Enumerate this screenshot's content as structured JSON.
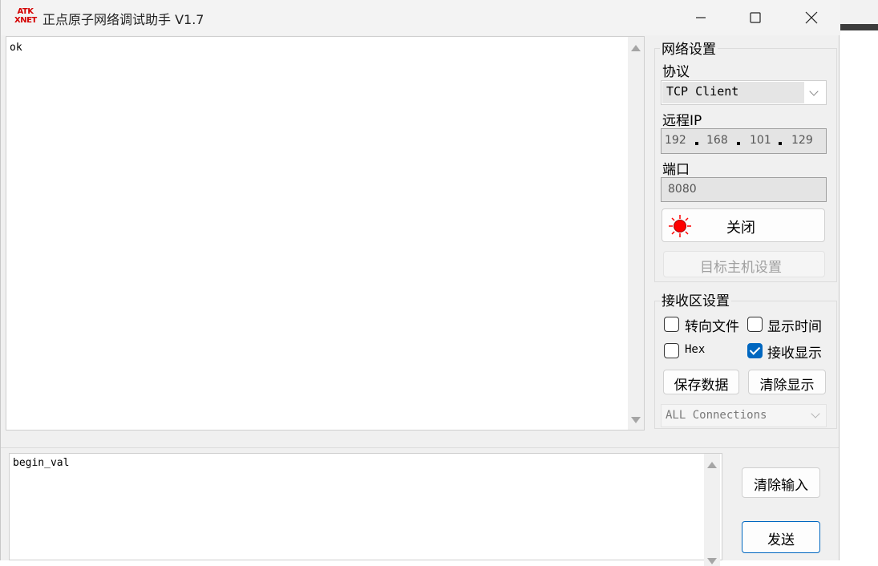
{
  "window": {
    "title": "正点原子网络调试助手 V1.7",
    "logo": {
      "line1": "ATK",
      "line2": "XNET"
    }
  },
  "receive": {
    "text": "ok"
  },
  "network": {
    "group_title": "网络设置",
    "protocol_label": "协议",
    "protocol_value": "TCP Client",
    "ip_label": "远程IP",
    "ip": [
      "192",
      "168",
      "101",
      "129"
    ],
    "port_label": "端口",
    "port_value": "8080",
    "close_label": "关闭",
    "host_label": "目标主机设置"
  },
  "recv_settings": {
    "group_title": "接收区设置",
    "redirect_label": "转向文件",
    "show_time_label": "显示时间",
    "hex_label": "Hex",
    "show_recv_label": "接收显示",
    "save_data_label": "保存数据",
    "clear_display_label": "清除显示",
    "connections_value": "ALL Connections"
  },
  "send": {
    "text": "begin_val",
    "clear_input_label": "清除输入",
    "send_label": "发送"
  },
  "colors": {
    "accent": "#0067c0",
    "led": "#ff0000"
  }
}
